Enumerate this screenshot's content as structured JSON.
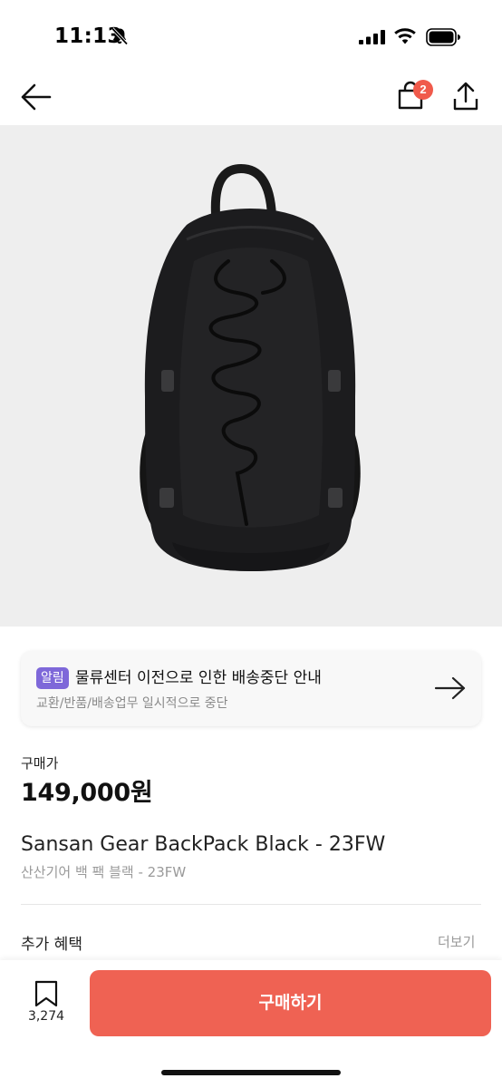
{
  "status": {
    "time": "11:13",
    "icons": [
      "bell-slash-icon",
      "signal-icon",
      "wifi-icon",
      "battery-icon"
    ]
  },
  "nav": {
    "back_icon": "arrow-left-icon",
    "cart_icon": "shopping-bag-icon",
    "cart_badge": "2",
    "share_icon": "share-icon"
  },
  "product_image": {
    "subject": "black backpack",
    "background": "#eeeeee"
  },
  "notice": {
    "tag": "알림",
    "title": "물류센터 이전으로 인한 배송중단 안내",
    "subtitle": "교환/반품/배송업무 일시적으로 중단",
    "arrow_icon": "arrow-right-icon",
    "tag_color": "#7e68d9"
  },
  "price": {
    "label": "구매가",
    "value": "149,000원"
  },
  "product": {
    "name": "Sansan Gear BackPack Black  - 23FW",
    "subtitle": "산산기어 백 팩 블랙 - 23FW"
  },
  "benefits": {
    "label": "추가 혜택",
    "more": "더보기"
  },
  "bottom": {
    "bookmark_icon": "bookmark-icon",
    "bookmark_count": "3,274",
    "buy_label": "구매하기",
    "buy_color": "#ef6253"
  }
}
